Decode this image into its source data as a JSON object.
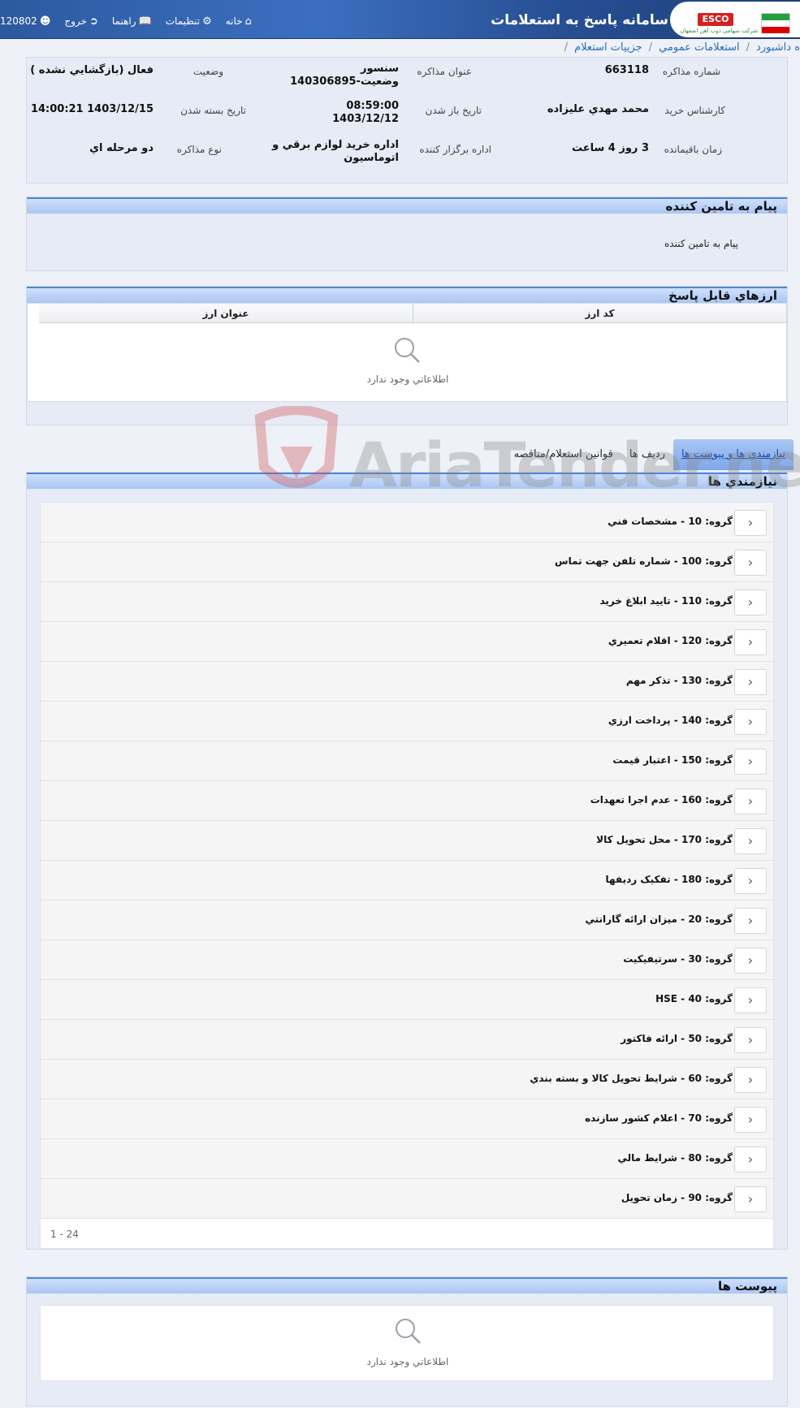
{
  "header": {
    "title": "سامانه پاسخ به استعلامات",
    "logo_text": "ESCO",
    "logo_subtitle": "شرکت سهامی ذوب آهن اصفهان",
    "home": "خانه",
    "settings": "تنظیمات",
    "help": "راهنما",
    "logout": "خروج",
    "user_id": "120802"
  },
  "breadcrumb": {
    "items": [
      "داشبورد",
      "استعلامات عمومي",
      "جزييات استعلام"
    ],
    "first_prefix": "ه"
  },
  "info": {
    "negotiation_number_label": "شماره مذاکره",
    "negotiation_number": "663118",
    "negotiation_title_label": "عنوان مذاکره",
    "negotiation_title_line1": "سنسور",
    "negotiation_title_line2": "وضعيت-140306895",
    "status_label": "وضعيت",
    "status": "فعال (بازگشايي نشده )",
    "buyer_expert_label": "کارشناس خريد",
    "buyer_expert": "محمد مهدي عليزاده",
    "open_date_label": "تاريخ باز شدن",
    "open_time": "08:59:00",
    "open_date": "1403/12/12",
    "close_date_label": "تاريخ بسته شدن",
    "close_date": "1403/12/15 14:00:21",
    "remaining_label": "زمان باقيمانده",
    "remaining": "3 روز 4 ساعت",
    "organizer_label": "اداره برگزار کننده",
    "organizer_line1": "اداره خريد لوازم برقي و",
    "organizer_line2": "اتوماسيون",
    "negotiation_type_label": "نوع مذاکره",
    "negotiation_type": "دو مرحله اي"
  },
  "supplier_message": {
    "title": "پيام به تامين کننده",
    "text": "پيام به تامين کننده"
  },
  "currencies": {
    "title": "ارزهاي قابل پاسخ",
    "col_code": "کد ارز",
    "col_title": "عنوان ارز",
    "empty": "اطلاعاتي وجود ندارد"
  },
  "tabs": [
    {
      "label": "نيازمندي ها و پيوست ها",
      "active": true
    },
    {
      "label": "رديف ها",
      "active": false
    },
    {
      "label": "قوانين استعلام/مناقصه",
      "active": false
    }
  ],
  "requirements": {
    "title": "نيازمندي ها",
    "groups": [
      "گروه: 10 - مشخصات فني",
      "گروه: 100 - شماره تلفن جهت تماس",
      "گروه: 110 - تاييد ابلاغ خريد",
      "گروه: 120 - اقلام تعميري",
      "گروه: 130 - تذکر مهم",
      "گروه: 140 - پرداخت ارزي",
      "گروه: 150 - اعتبار قيمت",
      "گروه: 160 - عدم اجرا تعهدات",
      "گروه: 170 - محل تحويل کالا",
      "گروه: 180 - تفکيک رديفها",
      "گروه: 20 - ميزان ارائه گارانتي",
      "گروه: 30 - سرتيفيکيت",
      "گروه: 40 - HSE",
      "گروه: 50 - ارائه فاکتور",
      "گروه: 60 - شرايط تحويل کالا و بسته بندي",
      "گروه: 70 - اعلام کشور سازنده",
      "گروه: 80 - شرايط مالي",
      "گروه: 90 - زمان تحويل"
    ],
    "pager": "1 - 24"
  },
  "attachments": {
    "title": "پيوست ها",
    "empty": "اطلاعاتي وجود ندارد"
  },
  "watermark": "AriaTender.neT",
  "colors": {
    "header_bg": "#2c5aa0",
    "panel_head": "#a9c6f3",
    "link": "#2a6bbf",
    "panel_bg": "#e7ebf5"
  }
}
